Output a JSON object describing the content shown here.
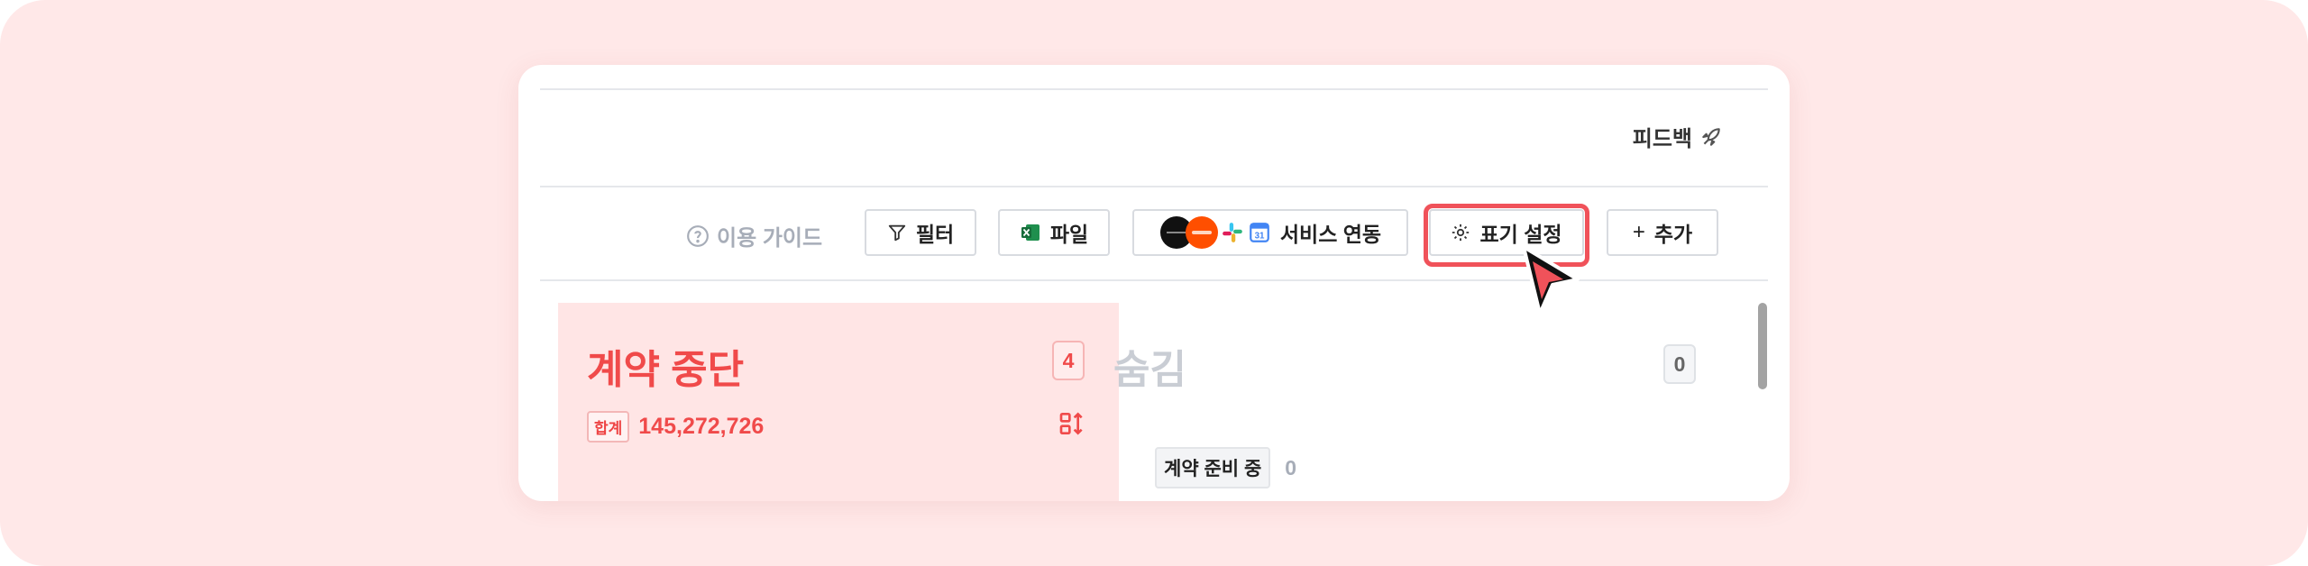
{
  "header": {
    "feedback_label": "피드백"
  },
  "toolbar": {
    "guide_label": "이용 가이드",
    "filter_label": "필터",
    "file_label": "파일",
    "integration_label": "서비스 연동",
    "display_settings_label": "표기 설정",
    "add_label": "추가",
    "add_symbol": "+"
  },
  "columns": [
    {
      "title": "계약 중단",
      "count": "4",
      "total_tag": "합계",
      "total_amount": "145,272,726"
    },
    {
      "title": "숨김",
      "count": "0",
      "subgroup": {
        "label": "계약 준비 중",
        "count": "0"
      }
    }
  ],
  "colors": {
    "accent": "#f04a4a",
    "highlight": "#f0525a",
    "column_bg": "#ffe5e5",
    "backdrop": "#ffe8e8"
  }
}
